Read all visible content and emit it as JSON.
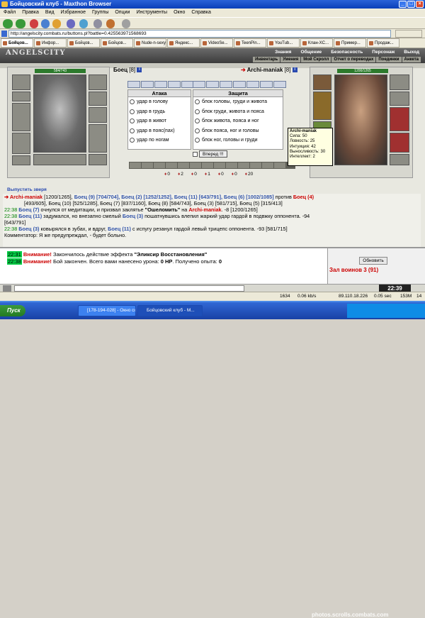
{
  "window": {
    "title": "Бойцовский клуб - Maxthon Browser"
  },
  "menu": [
    "Файл",
    "Правка",
    "Вид",
    "Избранное",
    "Группы",
    "Опции",
    "Инструменты",
    "Окно",
    "Справка"
  ],
  "address": {
    "url": "http://angelscity.combats.ru/buttons.pl?battle=0.425563971568693"
  },
  "tabs": [
    "Бойцов...",
    "Инфор...",
    "Бойцов...",
    "Бойцов...",
    "Nude-n-sexy...",
    "Яндекс...",
    "VideoSe...",
    "TeenPin...",
    "YouTub...",
    "Клан-XC...",
    "Пример...",
    "Продаж..."
  ],
  "game": {
    "logo": "ANGELSCITY",
    "topnav": [
      "Знания",
      "Общение",
      "Безопасность",
      "Персонаж",
      "Выход"
    ],
    "subnav": [
      "Инвентарь",
      "Умения",
      "Мой Скролл",
      "Отчет о переводах",
      "Поединки",
      "Анкета"
    ],
    "player": {
      "hp": "584/743",
      "name": "Боец",
      "level": "[8]"
    },
    "opponent": {
      "hp": "1200/1265",
      "name": "Archi-maniak",
      "level": "[8]"
    },
    "attack": {
      "title": "Атака",
      "options": [
        "удар в голову",
        "удар в грудь",
        "удар в живот",
        "удар в пояс(пах)",
        "удар по ногам"
      ]
    },
    "defense": {
      "title": "Защита",
      "options": [
        "блок головы, груди и живота",
        "блок груди, живота и пояса",
        "блок живота, пояса и ног",
        "блок пояса, ног и головы",
        "блок ног, головы и груди"
      ]
    },
    "forward_button": "Вперед !!!",
    "tooltip": {
      "name": "Archi-maniak",
      "lines": [
        "Сила: 50",
        "Ловкость: 25",
        "Интуиция: 42",
        "Выносливость: 30",
        "Интеллект: 2"
      ]
    },
    "stats": [
      "0",
      "2",
      "0",
      "1",
      "0",
      "0",
      "20"
    ],
    "release_pet": "Выпустить зверя"
  },
  "log": {
    "line1a": "Archi-maniak",
    "line1b": " [1200/1265], ",
    "line1c": "Боец (9) [704/704], Боец (2) [1252/1252], Боец (11) [643/791], Боец (6) [1002/1085]",
    "line1d": " против ",
    "line1e": "Боец (4)",
    "line2": "[493/605], Боец (10) [525/1285], Боец (7) [837/1160], Боец (8) [584/743], Боец (3) [581/715], Боец (5) [315/413]",
    "e1_time": "22:38",
    "e1_a": "Боец (7)",
    "e1_b": " очнулся от медитации, и призвал заклятье ",
    "e1_c": "\"Ошеломить\"",
    "e1_d": " на ",
    "e1_e": "Archi-maniak",
    "e1_f": ". -8 [1200/1265]",
    "e2_time": "22:38",
    "e2_a": "Боец (11)",
    "e2_b": " задумался, но внезапно смелый ",
    "e2_c": "Боец (3)",
    "e2_d": " пошатнувшись влепил жаркий удар гардой в подвжку оппонента. -94",
    "e2_e": "[643/791]",
    "e3_time": "22:38",
    "e3_a": "Боец (3)",
    "e3_b": " ковырялся в зубах, и вдруг, ",
    "e3_c": "Боец (11)",
    "e3_d": " с испугу резанул гардой левый трицепс оппонента. -93 [581/715]",
    "e4": "Комментатор: Я же предупреждал, - будет больно."
  },
  "chat": {
    "l1_time": "22:31",
    "l1_warn": "Внимание!",
    "l1_text": " Закончилось действие эффекта ",
    "l1_bold": "\"Эликсир Восстановления\"",
    "l2_time": "22:38",
    "l2_warn": "Внимание!",
    "l2_text": " Бой закончен. Всего вами нанесено урона: ",
    "l2_bold": "0 HP",
    "l2_text2": ". Получено опыта: ",
    "l2_bold2": "0",
    "refresh": "Обновить",
    "room": "Зал воинов 3 (91)"
  },
  "clock": "22:39",
  "statusbar": {
    "count": "1634",
    "speed": "0.06 kb/s",
    "ip": "89.110.18.226",
    "time": "0.05 sec",
    "mem": "153M",
    "num": "14"
  },
  "taskbar": {
    "start": "Пуск",
    "items": [
      "[178-194-028] - Окно со...",
      "Бойцовский клуб - M..."
    ],
    "watermark": "photos.scrolls.combats.com"
  }
}
